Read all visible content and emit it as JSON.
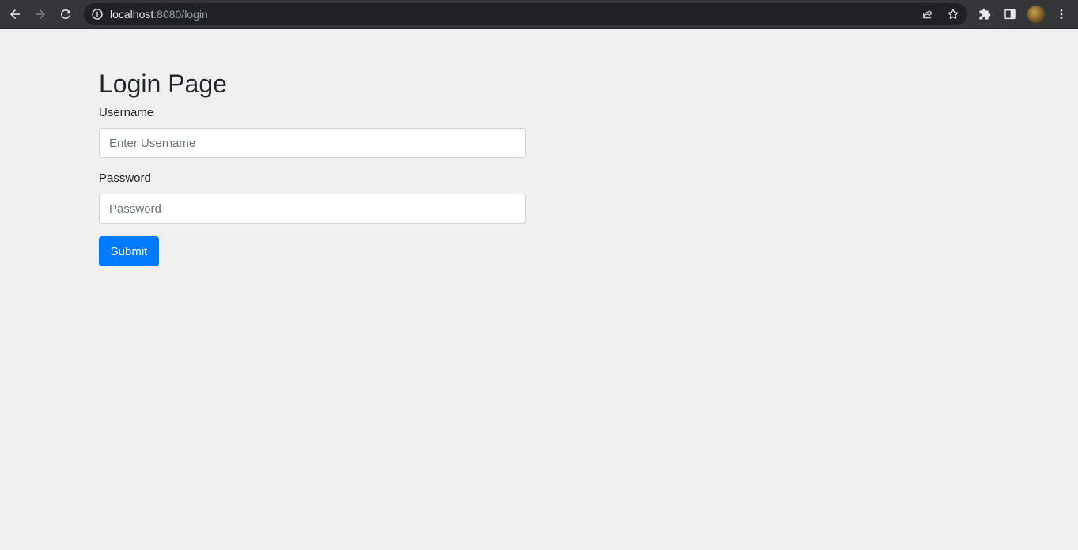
{
  "browser": {
    "url_host": "localhost",
    "url_rest": ":8080/login"
  },
  "page": {
    "title": "Login Page",
    "username_label": "Username",
    "username_placeholder": "Enter Username",
    "password_label": "Password",
    "password_placeholder": "Password",
    "submit_label": "Submit"
  },
  "colors": {
    "primary": "#007bff",
    "background": "#f0f0f0",
    "chrome": "#35363a"
  }
}
